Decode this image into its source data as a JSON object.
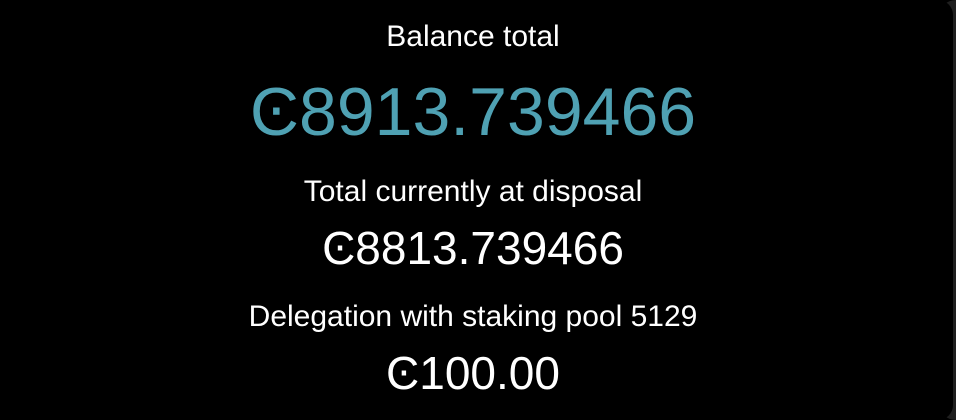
{
  "balance": {
    "total_label": "Balance total",
    "total_value": "Ͼ8913.739466",
    "disposal_label": "Total currently at disposal",
    "disposal_value": "Ͼ8813.739466",
    "delegation_label": "Delegation with staking pool 5129",
    "delegation_value": "Ͼ100.00"
  },
  "colors": {
    "background": "#000000",
    "accent": "#4fa1b3",
    "text": "#ffffff"
  }
}
